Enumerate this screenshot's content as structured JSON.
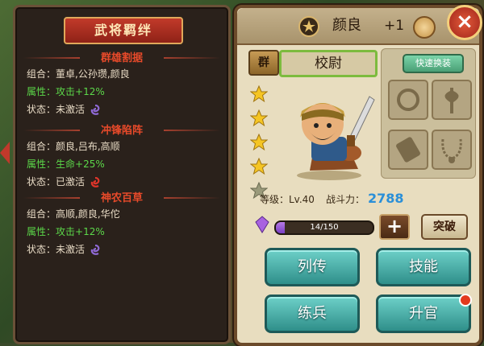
{
  "left_panel": {
    "title": "武将羁绊",
    "sections": [
      {
        "name": "群雄割据",
        "combo_label": "组合：",
        "combo": "董卓,公孙瓒,颜良",
        "attr_label": "属性：",
        "attr": "攻击+12%",
        "status_label": "状态：",
        "status": "未激活",
        "active": false
      },
      {
        "name": "冲锋陷阵",
        "combo_label": "组合：",
        "combo": "颜良,吕布,高顺",
        "attr_label": "属性：",
        "attr": "生命+25%",
        "status_label": "状态：",
        "status": "已激活",
        "active": true
      },
      {
        "name": "神农百草",
        "combo_label": "组合：",
        "combo": "高顺,颜良,华佗",
        "attr_label": "属性：",
        "attr": "攻击+12%",
        "status_label": "状态：",
        "status": "未激活",
        "active": false
      }
    ]
  },
  "hero": {
    "name": "颜良",
    "plus": "+1",
    "clan": "群",
    "rank": "校尉",
    "stars_filled": 4,
    "stars_total": 5,
    "level_label": "等级：Lv.40",
    "power_label": "战斗力：",
    "power_value": "2788",
    "exp_text": "14/150",
    "exp_fraction": 0.093
  },
  "equipment": {
    "quick_equip_label": "快速换装",
    "slots": [
      "ring-icon",
      "axe-icon",
      "scroll-icon",
      "necklace-icon"
    ]
  },
  "buttons": {
    "plus": "+",
    "breakthrough": "突破",
    "biography": "列传",
    "skills": "技能",
    "training": "练兵",
    "promote": "升官",
    "close": "×"
  },
  "colors": {
    "attr_green": "#5cd94a",
    "section_red": "#e84a2a",
    "power_blue": "#2a8fd8",
    "button_teal": "#2f8f8a"
  }
}
